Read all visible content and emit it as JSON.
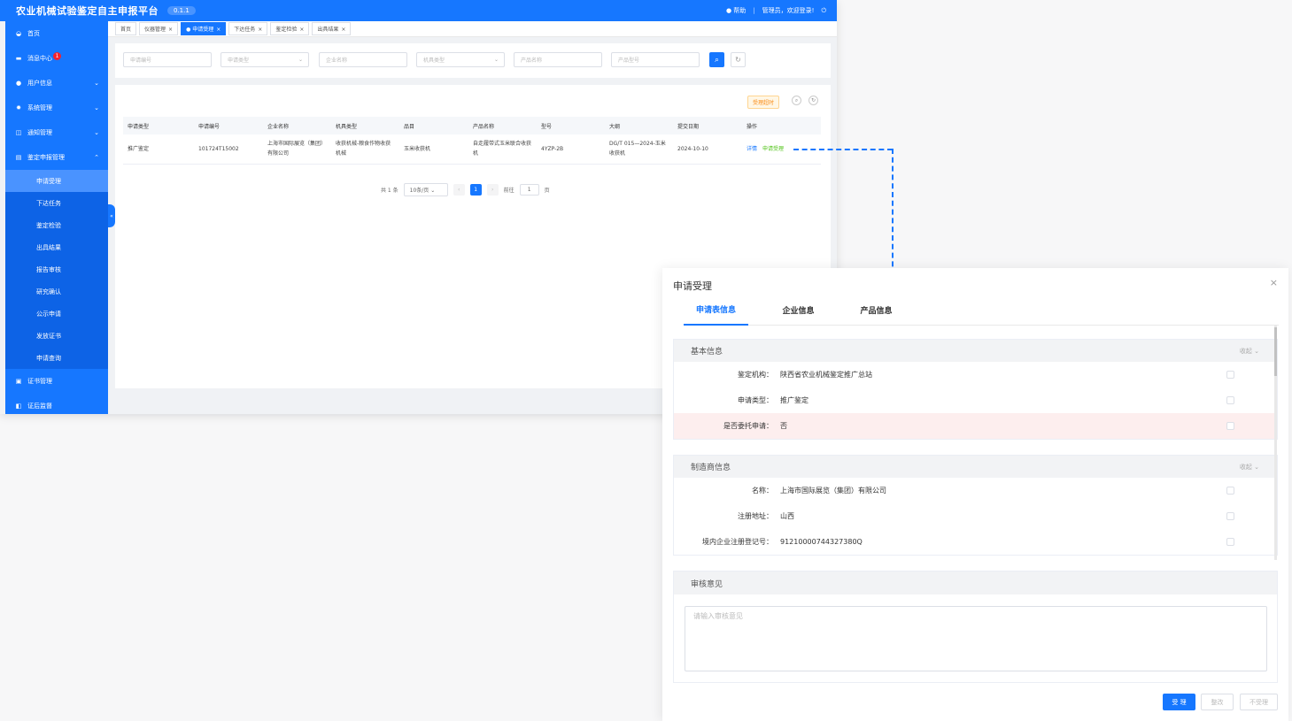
{
  "header": {
    "title": "农业机械试验鉴定自主申报平台",
    "version": "0.1.1",
    "help": "帮助",
    "welcome": "管理员，欢迎登录!"
  },
  "sidebar": {
    "items": [
      {
        "label": "首页",
        "icon": "dashboard-icon"
      },
      {
        "label": "消息中心",
        "icon": "message-icon",
        "badge": "1"
      },
      {
        "label": "用户信息",
        "icon": "user-icon"
      },
      {
        "label": "系统管理",
        "icon": "gear-icon"
      },
      {
        "label": "通知管理",
        "icon": "book-icon"
      },
      {
        "label": "鉴定申报管理",
        "icon": "document-icon"
      }
    ],
    "sub_items": [
      "申请受理",
      "下达任务",
      "鉴定检验",
      "出具结果",
      "报告审核",
      "研究确认",
      "公示申请",
      "发放证书",
      "申请查询"
    ],
    "bottom_items": [
      {
        "label": "证书管理",
        "icon": "certificate-icon"
      },
      {
        "label": "证后监督",
        "icon": "supervision-icon"
      }
    ]
  },
  "tabs": [
    "首页",
    "仪器管理",
    "申请受理",
    "下达任务",
    "鉴定检验",
    "出具结果"
  ],
  "search": {
    "placeholders": [
      "申请编号",
      "申请类型",
      "企业名称",
      "机具类型",
      "产品名称",
      "产品型号"
    ]
  },
  "toolbar": {
    "overtime_label": "受理超时"
  },
  "table": {
    "headers": [
      "申请类型",
      "申请编号",
      "企业名称",
      "机具类型",
      "品目",
      "产品名称",
      "型号",
      "大纲",
      "提交日期",
      "操作"
    ],
    "rows": [
      [
        "推广鉴定",
        "101724T15002",
        "上海市国际展览（集团）有限公司",
        "收获机械-粮食作物收获机械",
        "玉米收获机",
        "自走履带式玉米联合收获机",
        "4YZP-2B",
        "DG/T 015—2024-玉米收获机",
        "2024-10-10"
      ]
    ],
    "actions": {
      "detail": "详情",
      "accept": "申请受理"
    }
  },
  "pager": {
    "total": "共 1 条",
    "page_size": "10条/页",
    "current": "1",
    "goto_prefix": "前往",
    "goto_value": "1",
    "goto_suffix": "页"
  },
  "dialog": {
    "title": "申请受理",
    "tabs": [
      "申请表信息",
      "企业信息",
      "产品信息"
    ],
    "collapse_label": "收起",
    "sections": [
      {
        "title": "基本信息",
        "rows": [
          {
            "label": "鉴定机构：",
            "value": "陕西省农业机械鉴定推广总站"
          },
          {
            "label": "申请类型：",
            "value": "推广鉴定"
          },
          {
            "label": "是否委托申请：",
            "value": "否"
          }
        ]
      },
      {
        "title": "制造商信息",
        "rows": [
          {
            "label": "名称：",
            "value": "上海市国际展览（集团）有限公司"
          },
          {
            "label": "注册地址：",
            "value": "山西"
          },
          {
            "label": "境内企业注册登记号：",
            "value": "91210000744327380Q"
          }
        ]
      }
    ],
    "review": {
      "title": "审核意见",
      "placeholder": "请输入审核意见"
    },
    "buttons": {
      "accept": "受 理",
      "rectify": "整改",
      "reject": "不受理"
    }
  },
  "colors": {
    "primary": "#1677ff",
    "highlight_row": "#fdeeee",
    "success": "#52c41a"
  }
}
